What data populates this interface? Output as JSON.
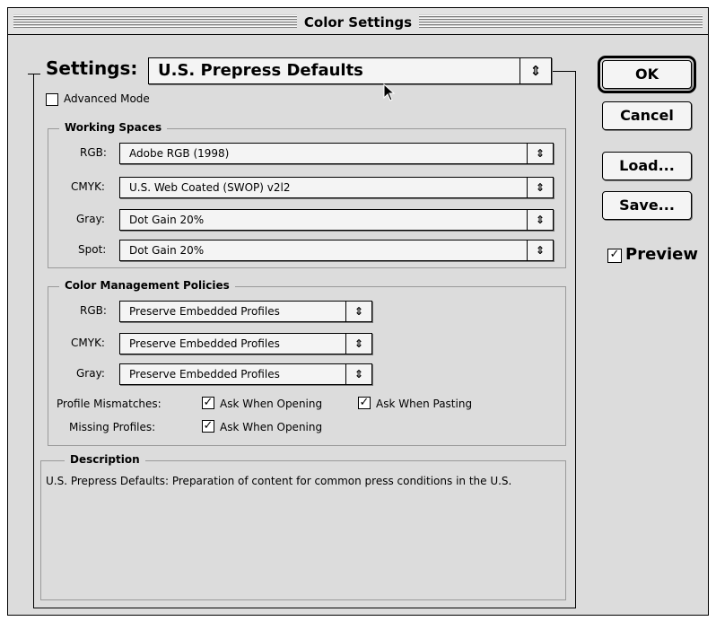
{
  "window": {
    "title": "Color Settings"
  },
  "settings": {
    "label": "Settings:",
    "selected": "U.S. Prepress Defaults",
    "advanced_mode_label": "Advanced Mode",
    "advanced_mode_checked": false
  },
  "working_spaces": {
    "title": "Working Spaces",
    "rows": [
      {
        "label": "RGB:",
        "value": "Adobe RGB (1998)"
      },
      {
        "label": "CMYK:",
        "value": "U.S. Web Coated (SWOP) v2l2"
      },
      {
        "label": "Gray:",
        "value": "Dot Gain 20%"
      },
      {
        "label": "Spot:",
        "value": "Dot Gain 20%"
      }
    ]
  },
  "policies": {
    "title": "Color Management Policies",
    "rows": [
      {
        "label": "RGB:",
        "value": "Preserve Embedded Profiles"
      },
      {
        "label": "CMYK:",
        "value": "Preserve Embedded Profiles"
      },
      {
        "label": "Gray:",
        "value": "Preserve Embedded Profiles"
      }
    ],
    "profile_mismatches_label": "Profile Mismatches:",
    "ask_when_opening_label": "Ask When Opening",
    "ask_when_pasting_label": "Ask When Pasting",
    "missing_profiles_label": "Missing Profiles:",
    "missing_ask_when_opening_label": "Ask When Opening",
    "ask_when_opening_checked": true,
    "ask_when_pasting_checked": true,
    "missing_ask_when_opening_checked": true
  },
  "description": {
    "title": "Description",
    "text": "U.S. Prepress Defaults:  Preparation of content for common press conditions in the U.S."
  },
  "buttons": {
    "ok": "OK",
    "cancel": "Cancel",
    "load": "Load...",
    "save": "Save..."
  },
  "preview": {
    "label": "Preview",
    "checked": true
  },
  "glyphs": {
    "popup_arrow": "⇕",
    "checkmark": "✓"
  }
}
